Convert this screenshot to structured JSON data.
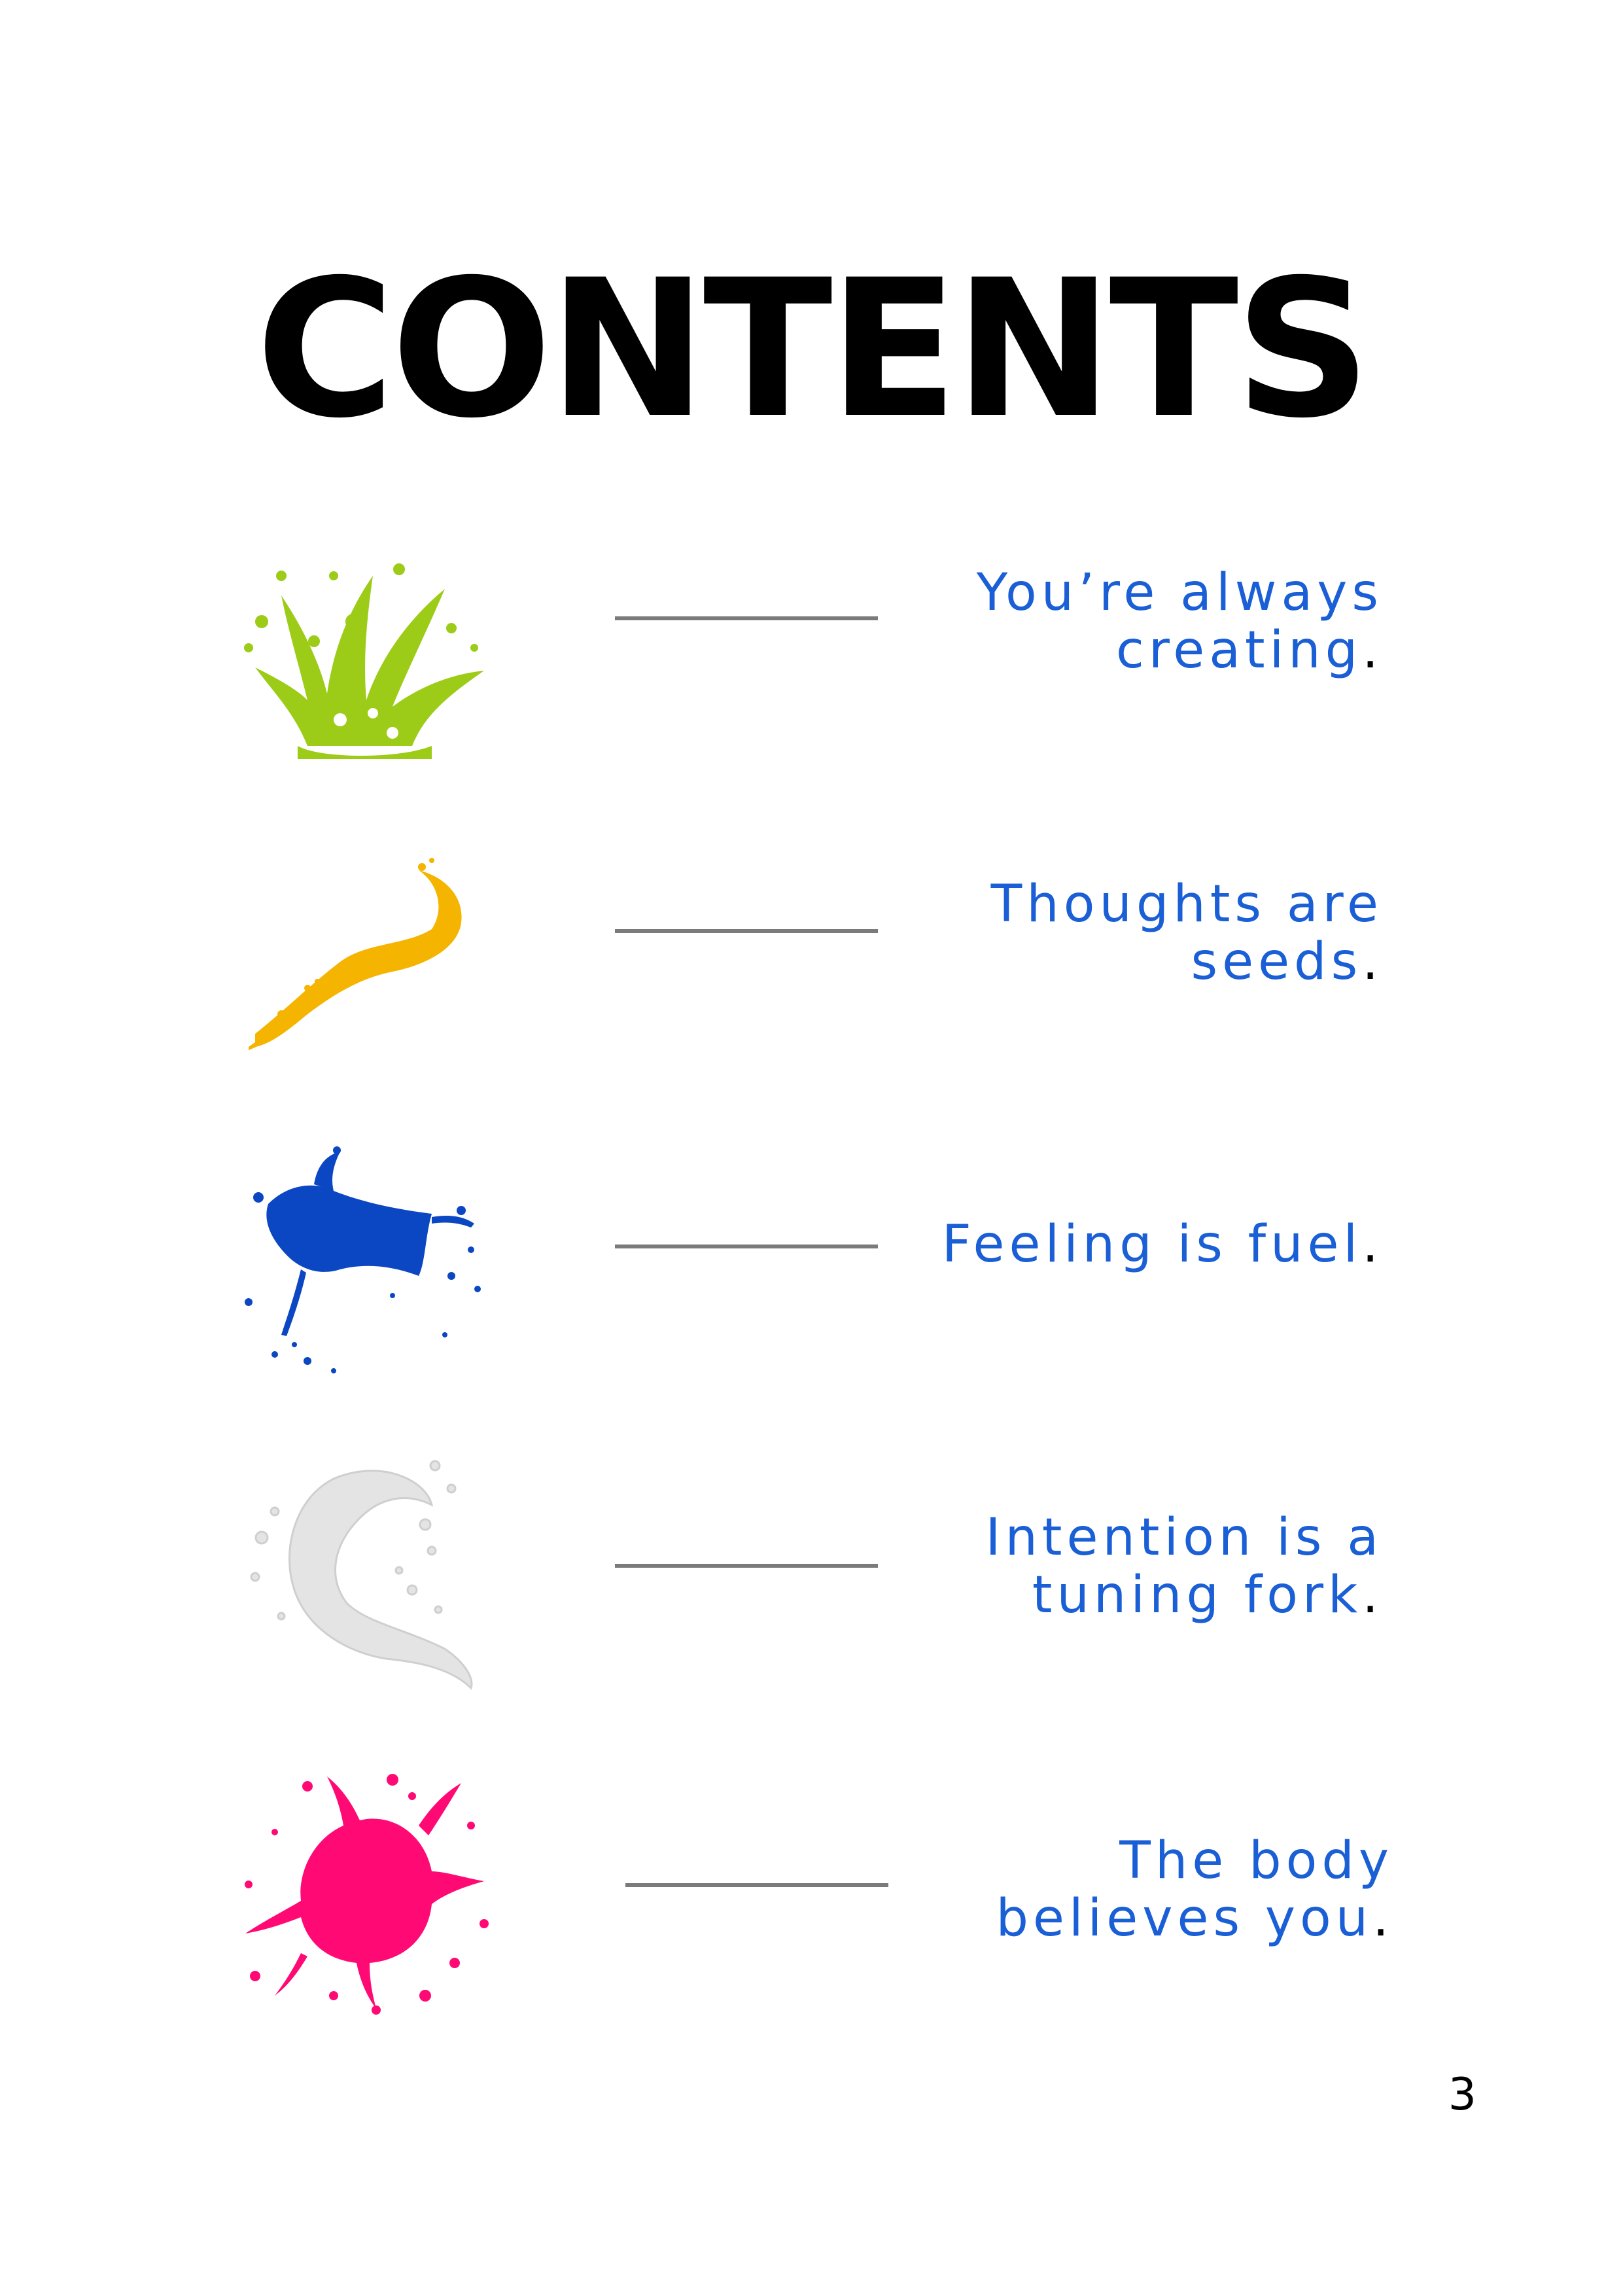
{
  "title": "CONTENTS",
  "entries": [
    {
      "line1": "You’re always",
      "line2": "creating",
      "end": ".",
      "splash_color": "#9ccc17",
      "splash_icon": "green-splash-icon"
    },
    {
      "line1": "Thoughts are",
      "line2": "seeds",
      "end": ".",
      "splash_color": "#f5b400",
      "splash_icon": "yellow-splash-icon"
    },
    {
      "line1": "",
      "line2": "Feeling is fuel",
      "end": ".",
      "splash_color": "#0b47c2",
      "splash_icon": "blue-splash-icon"
    },
    {
      "line1": "Intention is a",
      "line2": "tuning fork",
      "end": ".",
      "splash_color": "#e6e6e6",
      "splash_icon": "white-splash-icon"
    },
    {
      "line1": "The body",
      "line2": "believes you",
      "end": ".",
      "splash_color": "#ff0a74",
      "splash_icon": "pink-splash-icon"
    }
  ],
  "page_number": "3",
  "colors": {
    "entry_text": "#1a5fd6",
    "rule": "#7b7b7b",
    "title": "#000000"
  }
}
